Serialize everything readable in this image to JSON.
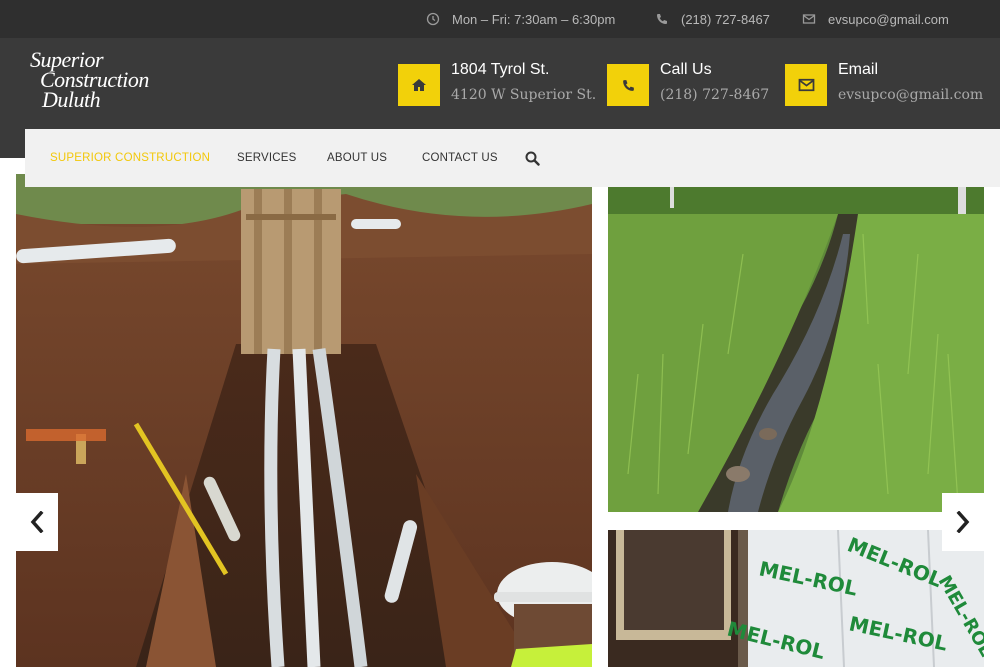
{
  "topbar": {
    "hours": "Mon – Fri: 7:30am – 6:30pm",
    "phone": "(218) 727-8467",
    "email": "evsupco@gmail.com"
  },
  "logo": {
    "line1": "Superior",
    "line2": "Construction",
    "line3": "Duluth"
  },
  "contacts": [
    {
      "title": "1804 Tyrol St.",
      "subtitle": "4120 W Superior St.",
      "icon": "home-icon"
    },
    {
      "title": "Call Us",
      "subtitle": "(218) 727-8467",
      "icon": "phone-icon"
    },
    {
      "title": "Email",
      "subtitle": "evsupco@gmail.com",
      "icon": "envelope-icon"
    }
  ],
  "nav": {
    "items": [
      "SUPERIOR CONSTRUCTION",
      "SERVICES",
      "ABOUT US",
      "CONTACT US"
    ],
    "active_index": 0
  },
  "gallery": {
    "photos": [
      {
        "subject": "trench-with-pipes"
      },
      {
        "subject": "grassy-drainage-ditch"
      },
      {
        "subject": "wall-with-mel-rol-membrane",
        "text": "MEL-ROL"
      }
    ]
  },
  "colors": {
    "accent": "#f2d10a",
    "topbar_bg": "#2f2f2f",
    "header_bg": "#3a3a3a",
    "nav_bg": "#f1f1f1"
  }
}
